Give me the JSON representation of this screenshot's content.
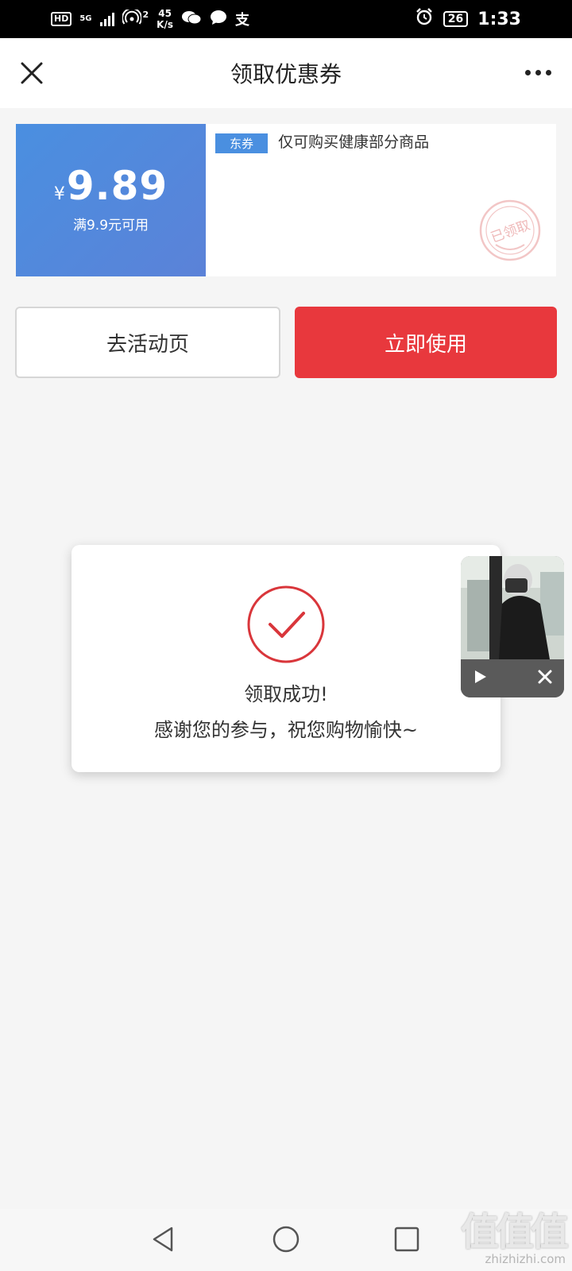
{
  "status_bar": {
    "hd": "HD",
    "network": "5G",
    "signal_sub": "2",
    "speed_value": "45",
    "speed_unit": "K/s",
    "alipay_glyph": "支",
    "battery": "26",
    "time": "1:33"
  },
  "navbar": {
    "title": "领取优惠券"
  },
  "coupon": {
    "currency": "¥",
    "amount": "9.89",
    "condition": "满9.9元可用",
    "tag": "东券",
    "description": "仅可购买健康部分商品",
    "stamp_text": "已领取",
    "accent_color": "#4a8fe0"
  },
  "buttons": {
    "activity": "去活动页",
    "use_now": "立即使用",
    "use_now_color": "#e8383d"
  },
  "dialog": {
    "title": "领取成功!",
    "message": "感谢您的参与，祝您购物愉快~"
  },
  "watermark": {
    "big": "值值值",
    "small": "zhizhizhi.com"
  }
}
